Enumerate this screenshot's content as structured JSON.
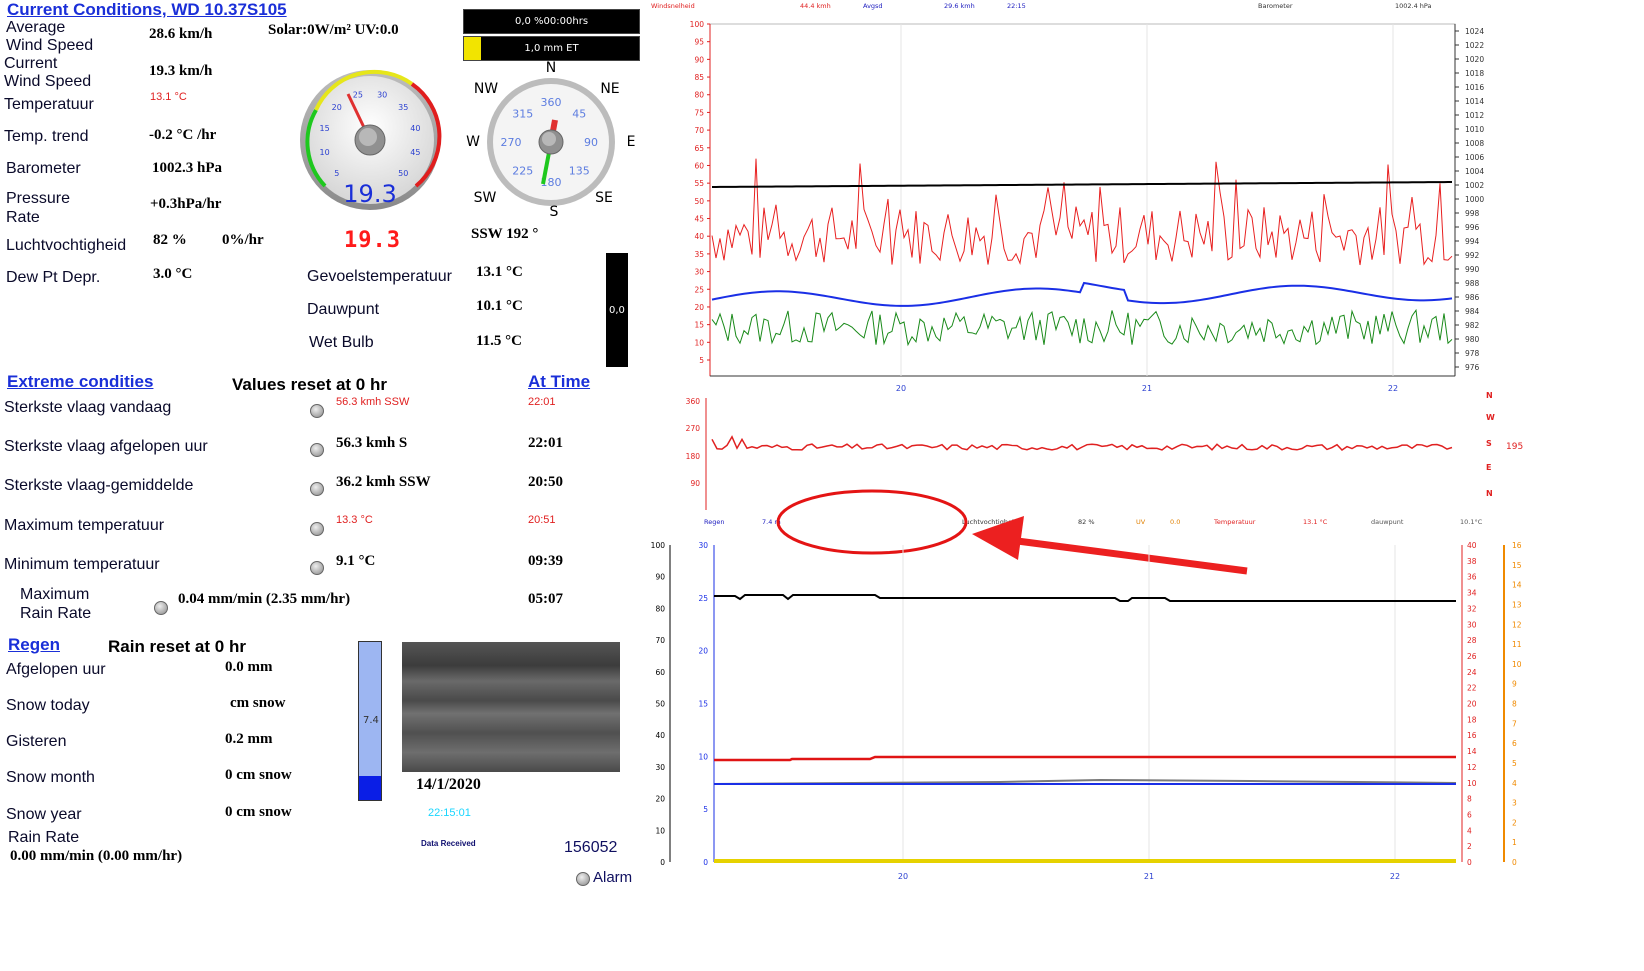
{
  "title": "Current Conditions, WD 10.37S105",
  "left": {
    "avg_wind_label": "Average\nWind Speed",
    "avg_wind": "28.6 km/h",
    "solar": "Solar:0W/m² UV:0.0",
    "cur_wind_label": "Current\nWind Speed",
    "cur_wind": "19.3 km/h",
    "temp_label": "Temperatuur",
    "temp": "13.1 °C",
    "trend_label": "Temp. trend",
    "trend": "-0.2 °C /hr",
    "baro_label": "Barometer",
    "baro": "1002.3 hPa",
    "press_rate_label": "Pressure\nRate",
    "press_rate": "+0.3hPa/hr",
    "hum_label": "Luchtvochtigheid",
    "hum": "82 %",
    "hum_rate": "0%/hr",
    "dew_depr_label": "Dew Pt Depr.",
    "dew_depr": "3.0 °C"
  },
  "status_boxes": {
    "time": "0,0 %00:00hrs",
    "et": "1,0 mm ET"
  },
  "gauge": {
    "value": "19.3",
    "led": "19.3",
    "ticks": [
      "5",
      "10",
      "15",
      "20",
      "25",
      "30",
      "35",
      "40",
      "45",
      "50"
    ]
  },
  "compass": {
    "dirs": {
      "N": "N",
      "NE": "NE",
      "E": "E",
      "SE": "SE",
      "S": "S",
      "SW": "SW",
      "W": "W",
      "NW": "NW"
    },
    "degs": [
      "360",
      "45",
      "90",
      "135",
      "180",
      "225",
      "270",
      "315"
    ],
    "reading": "SSW  192 °"
  },
  "feels": {
    "feels_label": "Gevoelstemperatuur",
    "feels": "13.1 °C",
    "dew_label": "Dauwpunt",
    "dew": "10.1 °C",
    "wet_label": "Wet Bulb",
    "wet": "11.5 °C",
    "bar_value": "0,0"
  },
  "extremes": {
    "header": "Extreme condities",
    "reset": "Values reset at 0 hr",
    "at_time": "At Time",
    "rows": [
      {
        "label": "Sterkste vlaag vandaag",
        "value": "56.3 kmh SSW",
        "time": "22:01"
      },
      {
        "label": "Sterkste vlaag afgelopen uur",
        "value": "56.3 kmh   S",
        "time": "22:01"
      },
      {
        "label": "Sterkste vlaag-gemiddelde",
        "value": "36.2 kmh SSW",
        "time": "20:50"
      },
      {
        "label": "Maximum temperatuur",
        "value": "13.3 °C",
        "time": "20:51"
      },
      {
        "label": "Minimum temperatuur",
        "value": "9.1 °C",
        "time": "09:39"
      },
      {
        "label": "Maximum\nRain Rate",
        "value": "0.04 mm/min (2.35 mm/hr)",
        "time": "05:07"
      }
    ]
  },
  "rain": {
    "header": "Regen",
    "reset": "Rain reset at 0 hr",
    "rows": [
      {
        "label": "Afgelopen uur",
        "value": "0.0 mm"
      },
      {
        "label": "Snow today",
        "value": "cm snow"
      },
      {
        "label": "Gisteren",
        "value": "0.2 mm"
      },
      {
        "label": "Snow month",
        "value": "0 cm snow"
      },
      {
        "label": "Snow year",
        "value": "0 cm snow"
      }
    ],
    "rate_label": "Rain Rate",
    "rate": "0.00 mm/min (0.00 mm/hr)",
    "bar_value": "7.4"
  },
  "bottom": {
    "date": "14/1/2020",
    "time": "22:15:01",
    "data_received": "Data Received",
    "count": "156052",
    "alarm": "Alarm"
  },
  "top_chart": {
    "header": [
      {
        "text": "Windsnelheid",
        "color": "#e02020"
      },
      {
        "text": "44.4 kmh",
        "color": "#e02020"
      },
      {
        "text": "Avgsd",
        "color": "#2020c0"
      },
      {
        "text": "29.6 kmh",
        "color": "#2020c0"
      },
      {
        "text": "22:15",
        "color": "#2020c0"
      },
      {
        "text": "Barometer",
        "color": "#333333"
      },
      {
        "text": "1002.4 hPa",
        "color": "#333333"
      }
    ],
    "left_ticks": [
      "100",
      "95",
      "90",
      "85",
      "80",
      "75",
      "70",
      "65",
      "60",
      "55",
      "50",
      "45",
      "40",
      "35",
      "30",
      "25",
      "20",
      "15",
      "10",
      "5"
    ],
    "right_ticks": [
      "1024",
      "1022",
      "1020",
      "1018",
      "1016",
      "1014",
      "1012",
      "1010",
      "1008",
      "1006",
      "1004",
      "1002",
      "1000",
      "998",
      "996",
      "994",
      "992",
      "990",
      "988",
      "986",
      "984",
      "982",
      "980",
      "978",
      "976"
    ],
    "x_ticks": [
      "20",
      "21",
      "22"
    ]
  },
  "dir_chart": {
    "ticks": [
      "360",
      "270",
      "180",
      "90"
    ],
    "right_letters": [
      "N",
      "W",
      "S",
      "E",
      "N"
    ],
    "reading": "195"
  },
  "bottom_chart": {
    "header": [
      {
        "text": "Regen",
        "color": "#2020c0"
      },
      {
        "text": "7.4 m",
        "color": "#2020c0"
      },
      {
        "text": "Luchtvochtigheid",
        "color": "#333333"
      },
      {
        "text": "82 %",
        "color": "#333333"
      },
      {
        "text": "UV",
        "color": "#e08000"
      },
      {
        "text": "0.0",
        "color": "#e08000"
      },
      {
        "text": "Temperatuur",
        "color": "#e02020"
      },
      {
        "text": "13.1 °C",
        "color": "#e02020"
      },
      {
        "text": "dauwpunt",
        "color": "#555555"
      },
      {
        "text": "10.1°C",
        "color": "#555555"
      }
    ],
    "pct_ticks": [
      "100",
      "90",
      "80",
      "70",
      "60",
      "50",
      "40",
      "30",
      "20",
      "10",
      "0"
    ],
    "blue_ticks": [
      "30",
      "25",
      "20",
      "15",
      "10",
      "5",
      "0"
    ],
    "red_ticks": [
      "40",
      "38",
      "36",
      "34",
      "32",
      "30",
      "28",
      "26",
      "24",
      "22",
      "20",
      "18",
      "16",
      "14",
      "12",
      "10",
      "8",
      "6",
      "4",
      "2",
      "0"
    ],
    "orange_ticks": [
      "16",
      "15",
      "14",
      "13",
      "12",
      "11",
      "10",
      "9",
      "8",
      "7",
      "6",
      "5",
      "4",
      "3",
      "2",
      "1",
      "0"
    ],
    "x_ticks": [
      "20",
      "21",
      "22"
    ]
  }
}
